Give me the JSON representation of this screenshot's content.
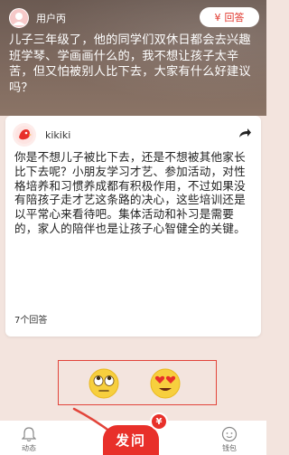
{
  "header": {
    "user_name": "用户丙",
    "answer_button_label": "回答",
    "answer_button_icon": "yen-icon",
    "question": "儿子三年级了，他的同学们双休日都会去兴趣班学琴、学画画什么的，我不想让孩子太辛苦，但又怕被别人比下去，大家有什么好建议吗？"
  },
  "answer_card": {
    "author": "kikiki",
    "share_icon": "share-arrow-icon",
    "text": "你是不想儿子被比下去，还是不想被其他家长比下去呢？小朋友学习才艺、参加活动，对性格培养和习惯养成都有积极作用，不过如果没有陪孩子走才艺这条路的决心，这些培训还是以平常心来看待吧。集体活动和补习是需要的，家人的陪伴也是让孩子心智健全的关键。",
    "answer_count": "7个回答"
  },
  "reactions": {
    "items": [
      "eye-roll-emoji-icon",
      "heart-eyes-emoji-icon"
    ]
  },
  "tabbar": {
    "left_label": "动态",
    "center_label": "发问",
    "right_label": "钱包",
    "badge": "¥"
  },
  "colors": {
    "accent": "#e8302a",
    "highlight_border": "#e2443a",
    "background": "#f3e4de"
  }
}
